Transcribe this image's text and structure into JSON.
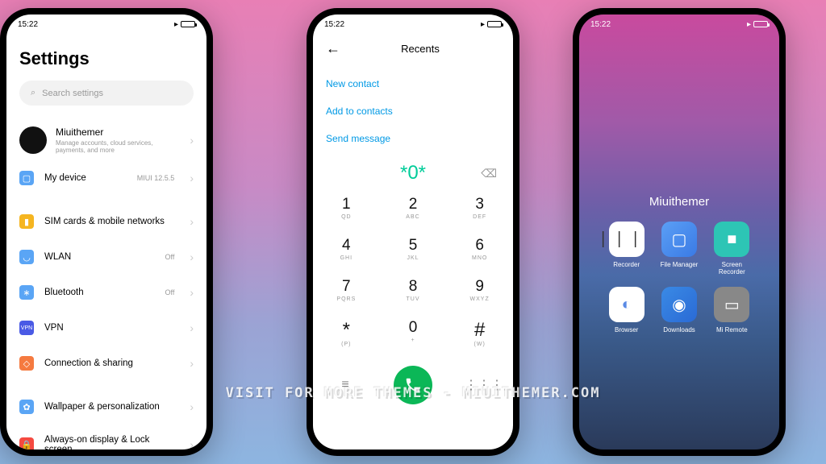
{
  "status": {
    "time": "15:22"
  },
  "dialer": {
    "title": "Recents",
    "links": [
      "New contact",
      "Add to contacts",
      "Send message"
    ],
    "entered": "*0*",
    "keys": [
      {
        "n": "1",
        "s": "QD"
      },
      {
        "n": "2",
        "s": "ABC"
      },
      {
        "n": "3",
        "s": "DEF"
      },
      {
        "n": "4",
        "s": "GHI"
      },
      {
        "n": "5",
        "s": "JKL"
      },
      {
        "n": "6",
        "s": "MNO"
      },
      {
        "n": "7",
        "s": "PQRS"
      },
      {
        "n": "8",
        "s": "TUV"
      },
      {
        "n": "9",
        "s": "WXYZ"
      },
      {
        "n": "*",
        "s": "(P)"
      },
      {
        "n": "0",
        "s": "+"
      },
      {
        "n": "#",
        "s": "(W)"
      }
    ]
  },
  "home": {
    "folder": "Miuithemer",
    "apps": [
      {
        "label": "Recorder",
        "cls": "i-rec",
        "glyph": "⎸⎸⎸"
      },
      {
        "label": "File Manager",
        "cls": "i-file",
        "glyph": "▢"
      },
      {
        "label": "Screen Recorder",
        "cls": "i-scr",
        "glyph": "■"
      },
      {
        "label": "Browser",
        "cls": "i-brw",
        "glyph": "◐"
      },
      {
        "label": "Downloads",
        "cls": "i-dl",
        "glyph": "◉"
      },
      {
        "label": "Mi Remote",
        "cls": "i-rem",
        "glyph": "▭"
      }
    ]
  },
  "settings": {
    "title": "Settings",
    "searchPlaceholder": "Search settings",
    "account": {
      "name": "Miuithemer",
      "sub": "Manage accounts, cloud services, payments, and more"
    },
    "rows": [
      {
        "icon": "i-dev",
        "label": "My device",
        "val": "MIUI 12.5.5",
        "glyph": "▢"
      },
      {
        "div": true
      },
      {
        "icon": "i-sim",
        "label": "SIM cards & mobile networks",
        "glyph": "▮"
      },
      {
        "icon": "i-wlan",
        "label": "WLAN",
        "val": "Off",
        "glyph": "◡"
      },
      {
        "icon": "i-bt",
        "label": "Bluetooth",
        "val": "Off",
        "glyph": "∗"
      },
      {
        "icon": "i-vpn",
        "label": "VPN",
        "glyph": "VPN"
      },
      {
        "icon": "i-conn",
        "label": "Connection & sharing",
        "glyph": "◇"
      },
      {
        "div": true
      },
      {
        "icon": "i-wall",
        "label": "Wallpaper & personalization",
        "glyph": "✿"
      },
      {
        "icon": "i-lock",
        "label": "Always-on display & Lock screen",
        "glyph": "🔒"
      }
    ]
  },
  "watermark": "VISIT FOR MORE THEMES - MIUITHEMER.COM"
}
